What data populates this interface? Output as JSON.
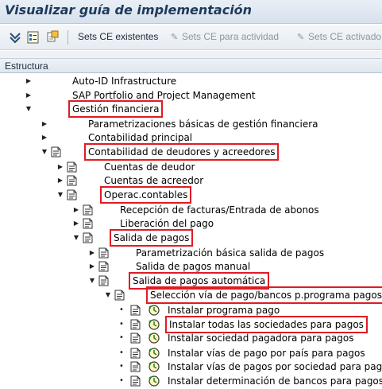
{
  "window": {
    "title": "Visualizar guía de implementación"
  },
  "toolbar": {
    "sets_existentes": "Sets CE existentes",
    "sets_actividad": "Sets CE para actividad",
    "sets_activado": "Sets CE activado"
  },
  "table": {
    "column_header": "Estructura"
  },
  "tree": {
    "rows": [
      {
        "label": "Auto-ID Infrastructure",
        "expander": "collapsed",
        "icon": "none",
        "highlight": false
      },
      {
        "label": "SAP Portfolio and Project Management",
        "expander": "collapsed",
        "icon": "none",
        "highlight": false
      },
      {
        "label": "Gestión financiera",
        "expander": "expanded",
        "icon": "none",
        "highlight": true
      },
      {
        "label": "Parametrizaciones básicas de gestión financiera",
        "expander": "collapsed",
        "icon": "none",
        "highlight": false
      },
      {
        "label": "Contabilidad principal",
        "expander": "collapsed",
        "icon": "none",
        "highlight": false
      },
      {
        "label": "Contabilidad de deudores y acreedores",
        "expander": "expanded",
        "icon": "doc-icon",
        "highlight": true
      },
      {
        "label": "Cuentas de deudor",
        "expander": "collapsed",
        "icon": "doc-icon",
        "highlight": false
      },
      {
        "label": "Cuentas de acreedor",
        "expander": "collapsed",
        "icon": "doc-icon",
        "highlight": false
      },
      {
        "label": "Operac.contables",
        "expander": "expanded",
        "icon": "doc-icon",
        "highlight": true
      },
      {
        "label": "Recepción de facturas/Entrada de abonos",
        "expander": "collapsed",
        "icon": "doc-icon",
        "highlight": false
      },
      {
        "label": "Liberación del pago",
        "expander": "collapsed",
        "icon": "doc-icon",
        "highlight": false
      },
      {
        "label": "Salida de pagos",
        "expander": "expanded",
        "icon": "doc-icon",
        "highlight": true
      },
      {
        "label": "Parametrización básica salida de pagos",
        "expander": "collapsed",
        "icon": "doc-icon",
        "highlight": false
      },
      {
        "label": "Salida de pagos manual",
        "expander": "collapsed",
        "icon": "doc-icon",
        "highlight": false
      },
      {
        "label": "Salida de pagos automática",
        "expander": "expanded",
        "icon": "doc-icon",
        "highlight": true
      },
      {
        "label": "Selección vía de pago/bancos p.programa pagos",
        "expander": "expanded",
        "icon": "doc-icon",
        "highlight": true
      },
      {
        "label": "Instalar programa pago",
        "expander": "bullet",
        "icon": "doc-clock-icon",
        "highlight": false
      },
      {
        "label": "Instalar todas las sociedades para pagos",
        "expander": "bullet",
        "icon": "doc-clock-icon",
        "highlight": true
      },
      {
        "label": "Instalar sociedad pagadora para pagos",
        "expander": "bullet",
        "icon": "doc-clock-icon",
        "highlight": false
      },
      {
        "label": "Instalar vías de pago por país para pagos",
        "expander": "bullet",
        "icon": "doc-clock-icon",
        "highlight": false
      },
      {
        "label": "Instalar vías de pagos por sociedad para pagos",
        "expander": "bullet",
        "icon": "doc-clock-icon",
        "highlight": false
      },
      {
        "label": "Instalar determinación de bancos para pagos",
        "expander": "bullet",
        "icon": "doc-clock-icon",
        "highlight": false
      }
    ]
  }
}
